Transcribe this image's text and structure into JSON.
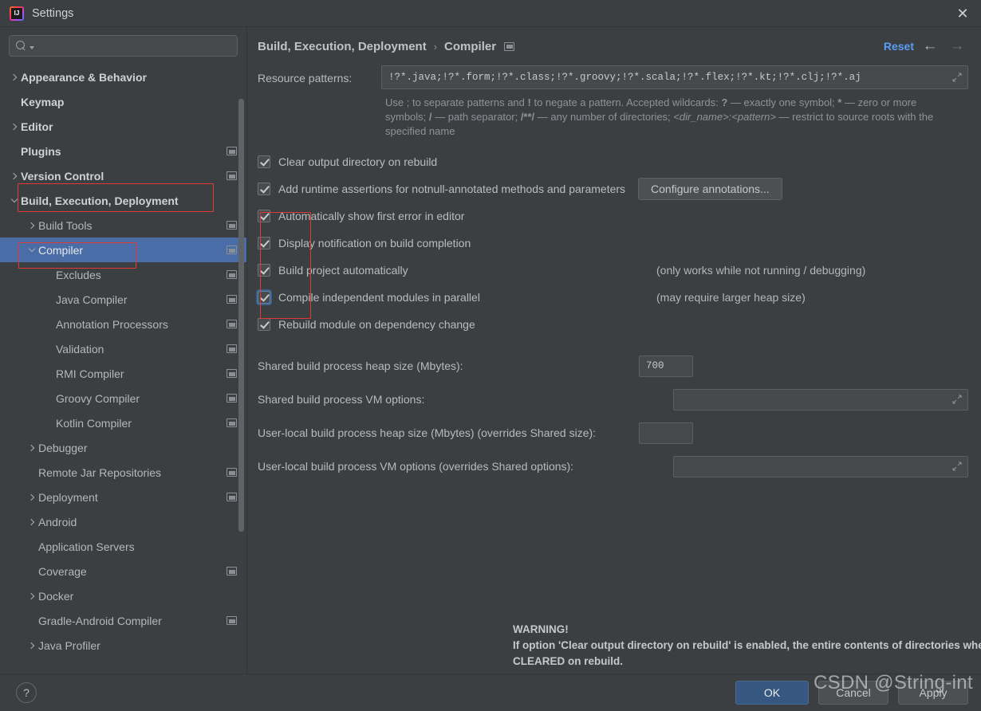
{
  "window": {
    "title": "Settings",
    "app_icon": "intellij-idea-icon",
    "close_icon": "close-icon"
  },
  "sidebar": {
    "search": {
      "placeholder": "",
      "value": "",
      "icon": "search-icon"
    },
    "items": [
      {
        "label": "Appearance & Behavior",
        "indent": 0,
        "arrow": "right",
        "bold": true,
        "badge": false,
        "selected": false
      },
      {
        "label": "Keymap",
        "indent": 0,
        "arrow": "none",
        "bold": true,
        "badge": false,
        "selected": false
      },
      {
        "label": "Editor",
        "indent": 0,
        "arrow": "right",
        "bold": true,
        "badge": false,
        "selected": false
      },
      {
        "label": "Plugins",
        "indent": 0,
        "arrow": "none",
        "bold": true,
        "badge": true,
        "selected": false
      },
      {
        "label": "Version Control",
        "indent": 0,
        "arrow": "right",
        "bold": true,
        "badge": true,
        "selected": false
      },
      {
        "label": "Build, Execution, Deployment",
        "indent": 0,
        "arrow": "down",
        "bold": true,
        "badge": false,
        "selected": false
      },
      {
        "label": "Build Tools",
        "indent": 1,
        "arrow": "right",
        "bold": false,
        "badge": true,
        "selected": false
      },
      {
        "label": "Compiler",
        "indent": 1,
        "arrow": "down",
        "bold": false,
        "badge": true,
        "selected": true
      },
      {
        "label": "Excludes",
        "indent": 2,
        "arrow": "none",
        "bold": false,
        "badge": true,
        "selected": false
      },
      {
        "label": "Java Compiler",
        "indent": 2,
        "arrow": "none",
        "bold": false,
        "badge": true,
        "selected": false
      },
      {
        "label": "Annotation Processors",
        "indent": 2,
        "arrow": "none",
        "bold": false,
        "badge": true,
        "selected": false
      },
      {
        "label": "Validation",
        "indent": 2,
        "arrow": "none",
        "bold": false,
        "badge": true,
        "selected": false
      },
      {
        "label": "RMI Compiler",
        "indent": 2,
        "arrow": "none",
        "bold": false,
        "badge": true,
        "selected": false
      },
      {
        "label": "Groovy Compiler",
        "indent": 2,
        "arrow": "none",
        "bold": false,
        "badge": true,
        "selected": false
      },
      {
        "label": "Kotlin Compiler",
        "indent": 2,
        "arrow": "none",
        "bold": false,
        "badge": true,
        "selected": false
      },
      {
        "label": "Debugger",
        "indent": 1,
        "arrow": "right",
        "bold": false,
        "badge": false,
        "selected": false
      },
      {
        "label": "Remote Jar Repositories",
        "indent": 1,
        "arrow": "none",
        "bold": false,
        "badge": true,
        "selected": false
      },
      {
        "label": "Deployment",
        "indent": 1,
        "arrow": "right",
        "bold": false,
        "badge": true,
        "selected": false
      },
      {
        "label": "Android",
        "indent": 1,
        "arrow": "right",
        "bold": false,
        "badge": false,
        "selected": false
      },
      {
        "label": "Application Servers",
        "indent": 1,
        "arrow": "none",
        "bold": false,
        "badge": false,
        "selected": false
      },
      {
        "label": "Coverage",
        "indent": 1,
        "arrow": "none",
        "bold": false,
        "badge": true,
        "selected": false
      },
      {
        "label": "Docker",
        "indent": 1,
        "arrow": "right",
        "bold": false,
        "badge": false,
        "selected": false
      },
      {
        "label": "Gradle-Android Compiler",
        "indent": 1,
        "arrow": "none",
        "bold": false,
        "badge": true,
        "selected": false
      },
      {
        "label": "Java Profiler",
        "indent": 1,
        "arrow": "right",
        "bold": false,
        "badge": false,
        "selected": false
      }
    ]
  },
  "header": {
    "crumb_root": "Build, Execution, Deployment",
    "crumb_sep": "›",
    "crumb_leaf": "Compiler",
    "project_badge_icon": "project-scope-icon",
    "reset_label": "Reset",
    "back_icon": "arrow-left-icon",
    "forward_icon": "arrow-right-icon",
    "reset_color": "#589df6"
  },
  "main": {
    "resource_patterns": {
      "label": "Resource patterns:",
      "value": "!?*.java;!?*.form;!?*.class;!?*.groovy;!?*.scala;!?*.flex;!?*.kt;!?*.clj;!?*.aj",
      "expand_icon": "expand-editor-icon"
    },
    "hint_line1_a": "Use ",
    "hint": "Use ; to separate patterns and ! to negate a pattern. Accepted wildcards: ? — exactly one symbol; * — zero or more symbols; / — path separator; /**/ — any number of directories; <dir_name>:<pattern> — restrict to source roots with the specified name",
    "checkboxes": [
      {
        "label": "Clear output directory on rebuild",
        "checked": true,
        "focused": false,
        "mnemonic_index": 1,
        "side_hint": ""
      },
      {
        "label": "Add runtime assertions for notnull-annotated methods and parameters",
        "checked": true,
        "focused": false,
        "mnemonic_index": 12,
        "side_hint": ""
      },
      {
        "label": "Automatically show first error in editor",
        "checked": true,
        "focused": false,
        "mnemonic_index": 25,
        "side_hint": ""
      },
      {
        "label": "Display notification on build completion",
        "checked": true,
        "focused": false,
        "mnemonic_index": -1,
        "side_hint": ""
      },
      {
        "label": "Build project automatically",
        "checked": true,
        "focused": false,
        "mnemonic_index": -1,
        "side_hint": "(only works while not running / debugging)"
      },
      {
        "label": "Compile independent modules in parallel",
        "checked": true,
        "focused": true,
        "mnemonic_index": -1,
        "side_hint": "(may require larger heap size)"
      },
      {
        "label": "Rebuild module on dependency change",
        "checked": true,
        "focused": false,
        "mnemonic_index": -1,
        "side_hint": ""
      }
    ],
    "configure_annotations_button": "Configure annotations...",
    "fields": [
      {
        "label": "Shared build process heap size (Mbytes):",
        "value": "700",
        "kind": "small",
        "expandable": false
      },
      {
        "label": "Shared build process VM options:",
        "value": "",
        "kind": "wide",
        "expandable": true
      },
      {
        "label": "User-local build process heap size (Mbytes) (overrides Shared size):",
        "value": "",
        "kind": "small",
        "expandable": false
      },
      {
        "label": "User-local build process VM options (overrides Shared options):",
        "value": "",
        "kind": "wide",
        "expandable": true
      }
    ],
    "warning_title": "WARNING!",
    "warning_body": "If option 'Clear output directory on rebuild' is enabled, the entire contents of directories where generated sources are stored WILL BE CLEARED on rebuild."
  },
  "footer": {
    "help_label": "?",
    "ok_label": "OK",
    "cancel_label": "Cancel",
    "apply_label": "Apply",
    "ok_color": "#365880"
  },
  "overlay": {
    "watermark": "CSDN @String-int"
  }
}
